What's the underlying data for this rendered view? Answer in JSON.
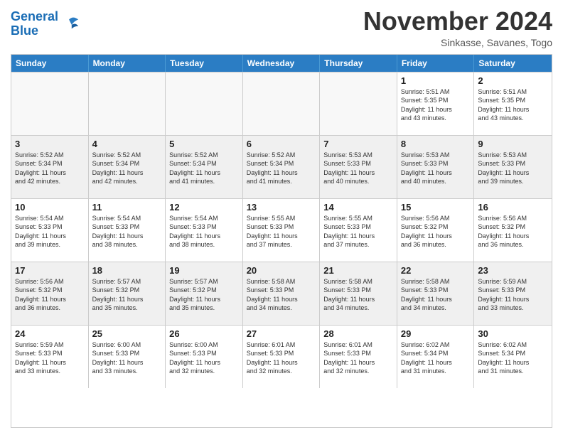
{
  "header": {
    "logo_line1": "General",
    "logo_line2": "Blue",
    "month_title": "November 2024",
    "location": "Sinkasse, Savanes, Togo"
  },
  "days_of_week": [
    "Sunday",
    "Monday",
    "Tuesday",
    "Wednesday",
    "Thursday",
    "Friday",
    "Saturday"
  ],
  "weeks": [
    [
      {
        "day": "",
        "empty": true
      },
      {
        "day": "",
        "empty": true
      },
      {
        "day": "",
        "empty": true
      },
      {
        "day": "",
        "empty": true
      },
      {
        "day": "",
        "empty": true
      },
      {
        "day": "1",
        "text": "Sunrise: 5:51 AM\nSunset: 5:35 PM\nDaylight: 11 hours\nand 43 minutes."
      },
      {
        "day": "2",
        "text": "Sunrise: 5:51 AM\nSunset: 5:35 PM\nDaylight: 11 hours\nand 43 minutes."
      }
    ],
    [
      {
        "day": "3",
        "text": "Sunrise: 5:52 AM\nSunset: 5:34 PM\nDaylight: 11 hours\nand 42 minutes."
      },
      {
        "day": "4",
        "text": "Sunrise: 5:52 AM\nSunset: 5:34 PM\nDaylight: 11 hours\nand 42 minutes."
      },
      {
        "day": "5",
        "text": "Sunrise: 5:52 AM\nSunset: 5:34 PM\nDaylight: 11 hours\nand 41 minutes."
      },
      {
        "day": "6",
        "text": "Sunrise: 5:52 AM\nSunset: 5:34 PM\nDaylight: 11 hours\nand 41 minutes."
      },
      {
        "day": "7",
        "text": "Sunrise: 5:53 AM\nSunset: 5:33 PM\nDaylight: 11 hours\nand 40 minutes."
      },
      {
        "day": "8",
        "text": "Sunrise: 5:53 AM\nSunset: 5:33 PM\nDaylight: 11 hours\nand 40 minutes."
      },
      {
        "day": "9",
        "text": "Sunrise: 5:53 AM\nSunset: 5:33 PM\nDaylight: 11 hours\nand 39 minutes."
      }
    ],
    [
      {
        "day": "10",
        "text": "Sunrise: 5:54 AM\nSunset: 5:33 PM\nDaylight: 11 hours\nand 39 minutes."
      },
      {
        "day": "11",
        "text": "Sunrise: 5:54 AM\nSunset: 5:33 PM\nDaylight: 11 hours\nand 38 minutes."
      },
      {
        "day": "12",
        "text": "Sunrise: 5:54 AM\nSunset: 5:33 PM\nDaylight: 11 hours\nand 38 minutes."
      },
      {
        "day": "13",
        "text": "Sunrise: 5:55 AM\nSunset: 5:33 PM\nDaylight: 11 hours\nand 37 minutes."
      },
      {
        "day": "14",
        "text": "Sunrise: 5:55 AM\nSunset: 5:33 PM\nDaylight: 11 hours\nand 37 minutes."
      },
      {
        "day": "15",
        "text": "Sunrise: 5:56 AM\nSunset: 5:32 PM\nDaylight: 11 hours\nand 36 minutes."
      },
      {
        "day": "16",
        "text": "Sunrise: 5:56 AM\nSunset: 5:32 PM\nDaylight: 11 hours\nand 36 minutes."
      }
    ],
    [
      {
        "day": "17",
        "text": "Sunrise: 5:56 AM\nSunset: 5:32 PM\nDaylight: 11 hours\nand 36 minutes."
      },
      {
        "day": "18",
        "text": "Sunrise: 5:57 AM\nSunset: 5:32 PM\nDaylight: 11 hours\nand 35 minutes."
      },
      {
        "day": "19",
        "text": "Sunrise: 5:57 AM\nSunset: 5:32 PM\nDaylight: 11 hours\nand 35 minutes."
      },
      {
        "day": "20",
        "text": "Sunrise: 5:58 AM\nSunset: 5:33 PM\nDaylight: 11 hours\nand 34 minutes."
      },
      {
        "day": "21",
        "text": "Sunrise: 5:58 AM\nSunset: 5:33 PM\nDaylight: 11 hours\nand 34 minutes."
      },
      {
        "day": "22",
        "text": "Sunrise: 5:58 AM\nSunset: 5:33 PM\nDaylight: 11 hours\nand 34 minutes."
      },
      {
        "day": "23",
        "text": "Sunrise: 5:59 AM\nSunset: 5:33 PM\nDaylight: 11 hours\nand 33 minutes."
      }
    ],
    [
      {
        "day": "24",
        "text": "Sunrise: 5:59 AM\nSunset: 5:33 PM\nDaylight: 11 hours\nand 33 minutes."
      },
      {
        "day": "25",
        "text": "Sunrise: 6:00 AM\nSunset: 5:33 PM\nDaylight: 11 hours\nand 33 minutes."
      },
      {
        "day": "26",
        "text": "Sunrise: 6:00 AM\nSunset: 5:33 PM\nDaylight: 11 hours\nand 32 minutes."
      },
      {
        "day": "27",
        "text": "Sunrise: 6:01 AM\nSunset: 5:33 PM\nDaylight: 11 hours\nand 32 minutes."
      },
      {
        "day": "28",
        "text": "Sunrise: 6:01 AM\nSunset: 5:33 PM\nDaylight: 11 hours\nand 32 minutes."
      },
      {
        "day": "29",
        "text": "Sunrise: 6:02 AM\nSunset: 5:34 PM\nDaylight: 11 hours\nand 31 minutes."
      },
      {
        "day": "30",
        "text": "Sunrise: 6:02 AM\nSunset: 5:34 PM\nDaylight: 11 hours\nand 31 minutes."
      }
    ]
  ]
}
